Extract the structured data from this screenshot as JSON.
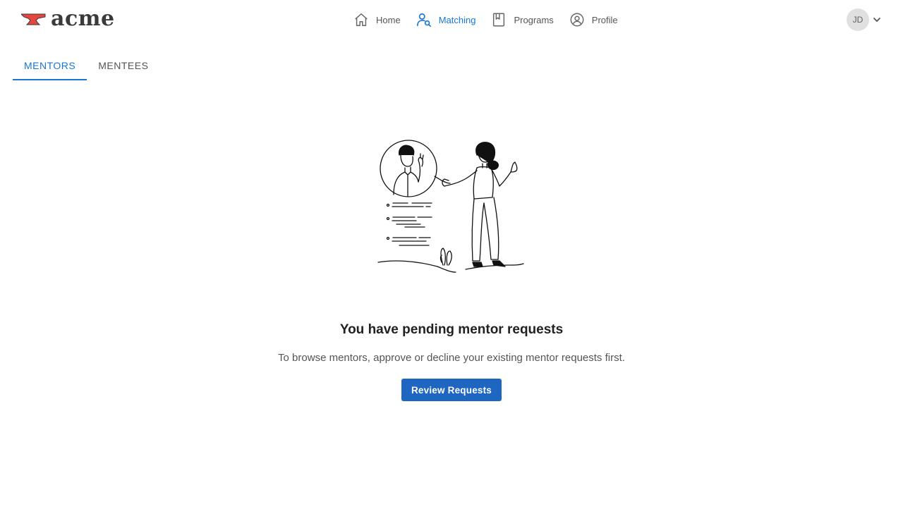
{
  "header": {
    "logo_text": "acme",
    "nav": [
      {
        "label": "Home",
        "icon": "home-icon",
        "active": false
      },
      {
        "label": "Matching",
        "icon": "matching-icon",
        "active": true
      },
      {
        "label": "Programs",
        "icon": "bookmark-icon",
        "active": false
      },
      {
        "label": "Profile",
        "icon": "profile-icon",
        "active": false
      }
    ],
    "user_initials": "JD"
  },
  "tabs": [
    {
      "label": "MENTORS",
      "active": true
    },
    {
      "label": "MENTEES",
      "active": false
    }
  ],
  "empty_state": {
    "title": "You have pending mentor requests",
    "description": "To browse mentors, approve or decline your existing mentor requests first.",
    "button_label": "Review Requests"
  },
  "colors": {
    "accent": "#1976d2",
    "button": "#1e66c1",
    "logo_anvil": "#e5473f"
  }
}
